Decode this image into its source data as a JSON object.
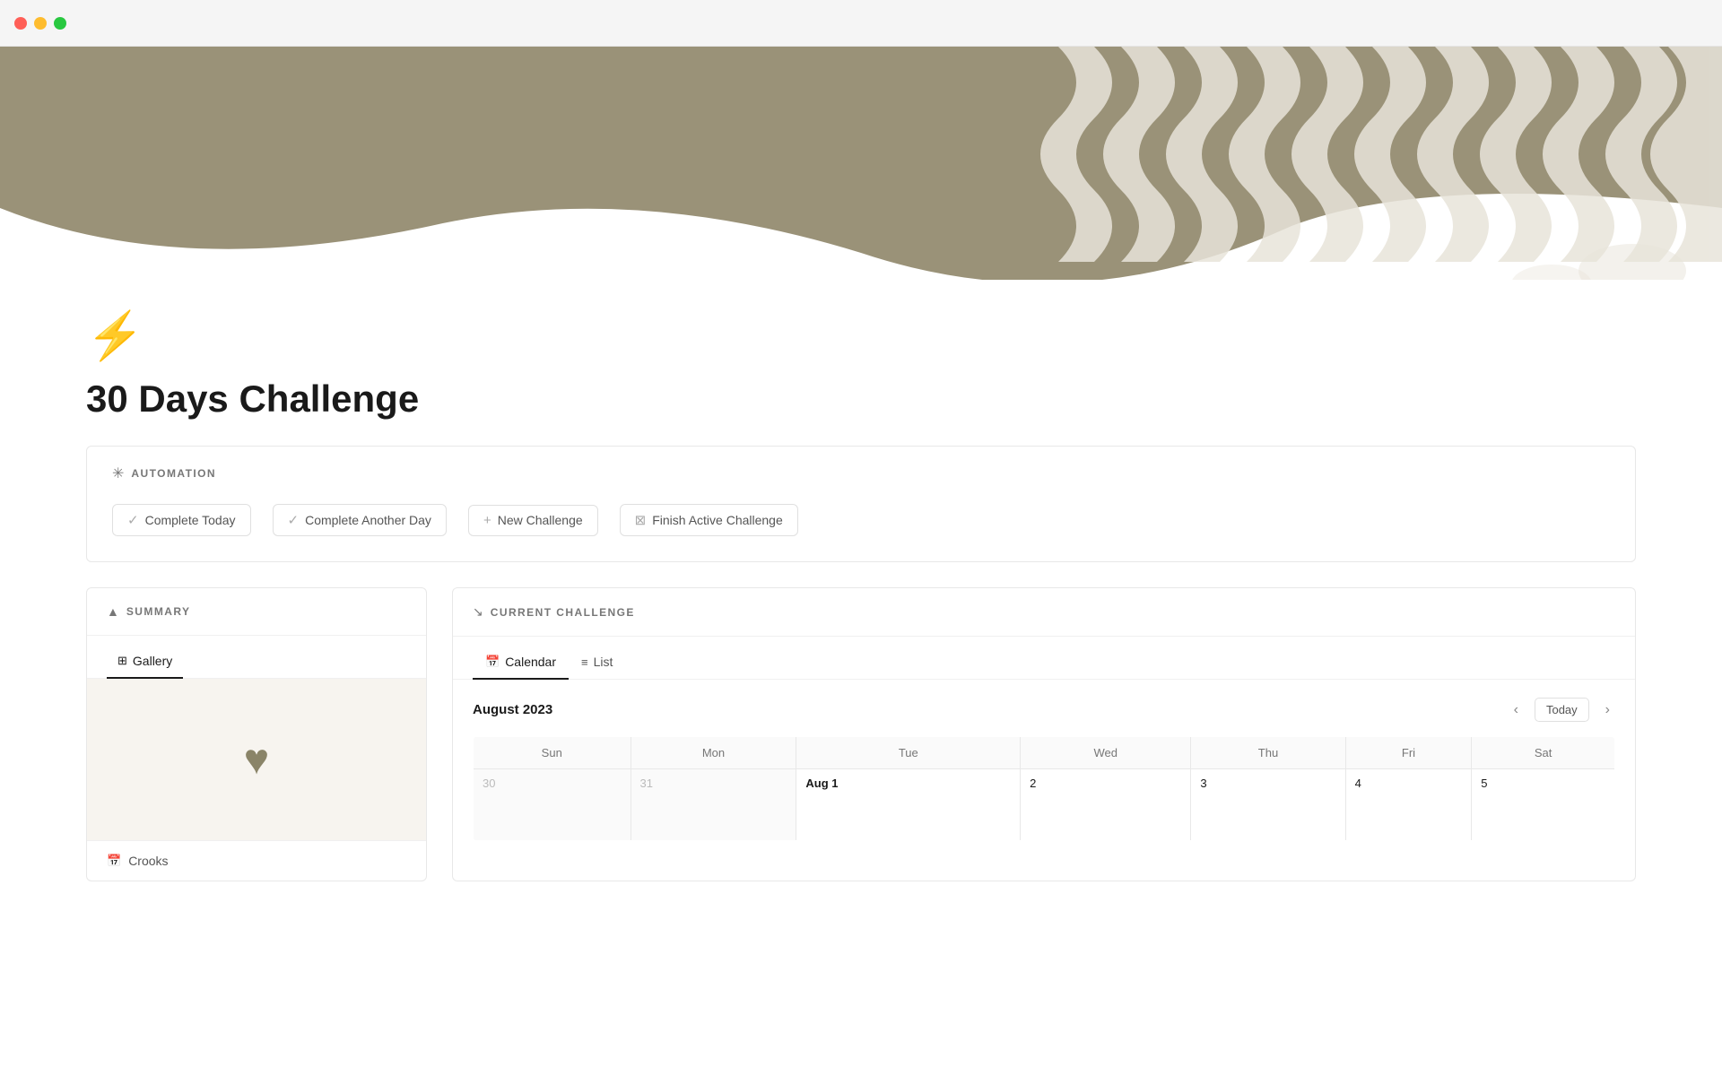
{
  "titlebar": {
    "traffic_lights": [
      "red",
      "yellow",
      "green"
    ]
  },
  "page": {
    "icon": "⚡",
    "title": "30 Days Challenge"
  },
  "automation": {
    "section_label": "AUTOMATION",
    "buttons": [
      {
        "id": "complete-today",
        "label": "Complete Today",
        "icon": "✓"
      },
      {
        "id": "complete-another-day",
        "label": "Complete Another Day",
        "icon": "✓"
      },
      {
        "id": "new-challenge",
        "label": "New Challenge",
        "icon": "+"
      },
      {
        "id": "finish-active-challenge",
        "label": "Finish Active Challenge",
        "icon": "⊠"
      }
    ]
  },
  "summary": {
    "section_label": "SUMMARY",
    "tabs": [
      {
        "id": "gallery",
        "label": "Gallery",
        "active": true
      }
    ],
    "footer_label": "Crooks"
  },
  "current_challenge": {
    "section_label": "CURRENT CHALLENGE",
    "tabs": [
      {
        "id": "calendar",
        "label": "Calendar",
        "active": true
      },
      {
        "id": "list",
        "label": "List",
        "active": false
      }
    ],
    "calendar": {
      "month_label": "August 2023",
      "today_btn": "Today",
      "day_headers": [
        "Sun",
        "Mon",
        "Tue",
        "Wed",
        "Thu",
        "Fri",
        "Sat"
      ],
      "weeks": [
        [
          {
            "day": "30",
            "other": true
          },
          {
            "day": "31",
            "other": true
          },
          {
            "day": "Aug 1",
            "special": true
          },
          {
            "day": "2"
          },
          {
            "day": "3"
          },
          {
            "day": "4"
          },
          {
            "day": "5"
          }
        ]
      ]
    }
  }
}
